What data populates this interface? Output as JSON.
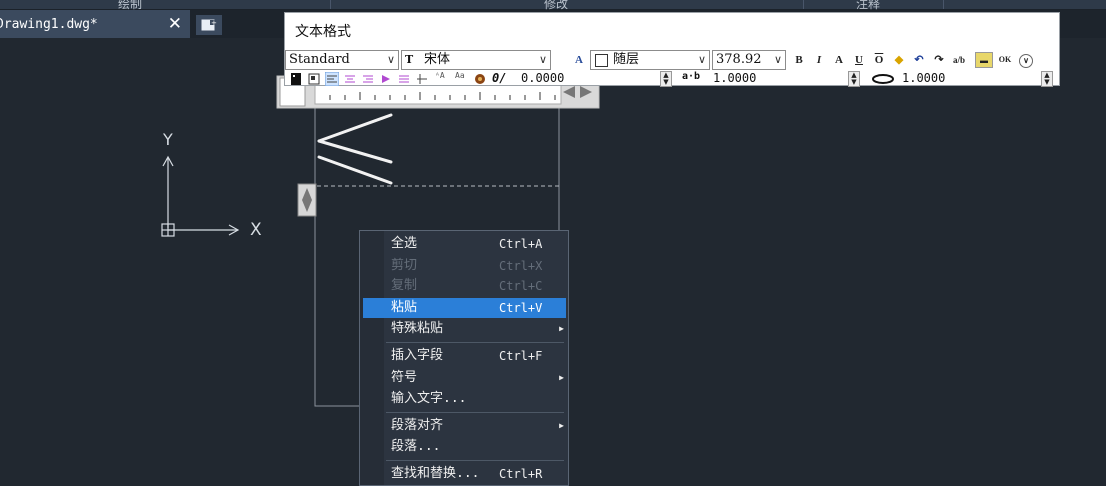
{
  "ribbon": {
    "group1": "绘制",
    "group2": "修改",
    "group3": "注释"
  },
  "tabs": {
    "document_tab": "Drawing1.dwg*",
    "close": "✕"
  },
  "text_format": {
    "title": "文本格式",
    "style": "Standard",
    "font": "宋体",
    "color": "随层",
    "height": "378.92",
    "oblique": "0.0000",
    "tracking": "1.0000",
    "width_factor": "1.0000"
  },
  "ucs": {
    "x_label": "X",
    "y_label": "Y"
  },
  "context_menu": {
    "items": [
      {
        "label": "全选",
        "shortcut": "Ctrl+A"
      },
      {
        "label": "剪切",
        "shortcut": "Ctrl+X"
      },
      {
        "label": "复制",
        "shortcut": "Ctrl+C"
      },
      {
        "label": "粘贴",
        "shortcut": "Ctrl+V"
      },
      {
        "label": "特殊粘贴",
        "shortcut": ""
      },
      {
        "label": "插入字段",
        "shortcut": "Ctrl+F"
      },
      {
        "label": "符号",
        "shortcut": ""
      },
      {
        "label": "输入文字...",
        "shortcut": ""
      },
      {
        "label": "段落对齐",
        "shortcut": ""
      },
      {
        "label": "段落...",
        "shortcut": ""
      },
      {
        "label": "查找和替换...",
        "shortcut": "Ctrl+R"
      }
    ],
    "submenu_arrow": "▶"
  },
  "colors": {
    "canvas": "#212830",
    "menu_highlight": "#2b7fd8",
    "tab_active": "#3b4a5e"
  }
}
